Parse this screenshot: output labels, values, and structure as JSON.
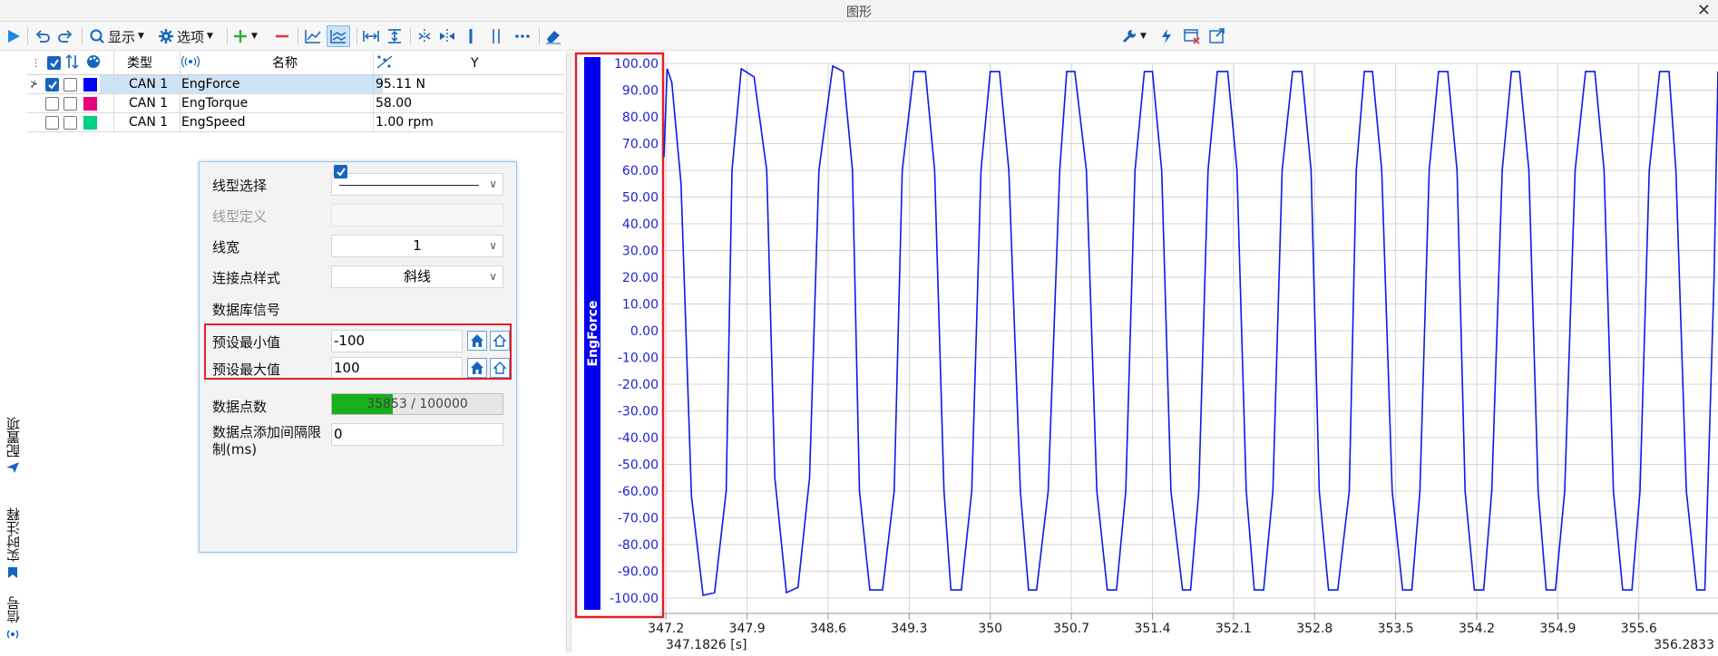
{
  "window": {
    "title": "图形",
    "close": "✕"
  },
  "toolbar": {
    "display_label": "显示",
    "options_label": "选项"
  },
  "colors": {
    "accent": "#1565c0",
    "signal_line": "#0a1ae8",
    "axis_band": "#0000ee",
    "highlight_red": "#e0202a",
    "progress_green": "#18b01a"
  },
  "icons": [
    "play-icon",
    "undo-icon",
    "redo-icon",
    "search-icon",
    "gear-icon",
    "plus-icon",
    "minus-icon",
    "line-chart-icon",
    "multi-line-chart-icon",
    "fit-horizontal-icon",
    "fit-vertical-icon",
    "cursor-cross-icon",
    "compare-icon",
    "cursor-line-icon",
    "double-cursor-icon",
    "more-icon",
    "eraser-icon",
    "wrench-icon",
    "lightning-icon",
    "delete-window-icon",
    "export-icon"
  ],
  "side_tabs": [
    {
      "label": "配置项",
      "icon": "plane-icon"
    },
    {
      "label": "实时注释",
      "icon": "bookmark-icon"
    },
    {
      "label": "信号",
      "icon": "signal-icon"
    }
  ],
  "signal_grid": {
    "headers": {
      "type": "类型",
      "name": "名称",
      "y": "Y"
    },
    "rows": [
      {
        "checked": true,
        "color": "#0000ff",
        "type": "CAN 1",
        "name": "EngForce",
        "value": "95.11 N",
        "selected": true
      },
      {
        "checked": false,
        "color": "#e6007e",
        "type": "CAN 1",
        "name": "EngTorque",
        "value": "58.00",
        "selected": false
      },
      {
        "checked": false,
        "color": "#00d080",
        "type": "CAN 1",
        "name": "EngSpeed",
        "value": "1.00 rpm",
        "selected": false
      }
    ]
  },
  "props": {
    "line_type_label": "线型选择",
    "line_def_label": "线型定义",
    "line_width_label": "线宽",
    "line_width_value": "1",
    "connector_label": "连接点样式",
    "connector_value": "斜线",
    "db_signal_label": "数据库信号",
    "db_signal_checked": true,
    "min_label": "预设最小值",
    "min_value": "-100",
    "max_label": "预设最大值",
    "max_value": "100",
    "points_label": "数据点数",
    "points_text": "35853 / 100000",
    "points_fraction": 0.35853,
    "interval_label": "数据点添加间隔限制(ms)",
    "interval_value": "0"
  },
  "chart_data": {
    "type": "line",
    "ylabel": "EngForce",
    "ylim": [
      -100,
      100
    ],
    "xlim": [
      347.1826,
      356.2833
    ],
    "y_ticks": [
      "100.00",
      "90.00",
      "80.00",
      "70.00",
      "60.00",
      "50.00",
      "40.00",
      "30.00",
      "20.00",
      "10.00",
      "0.00",
      "-10.00",
      "-20.00",
      "-30.00",
      "-40.00",
      "-50.00",
      "-60.00",
      "-70.00",
      "-80.00",
      "-90.00",
      "-100.00"
    ],
    "x_ticks": [
      "347.2",
      "347.9",
      "348.6",
      "349.3",
      "350",
      "350.7",
      "351.4",
      "352.1",
      "352.8",
      "353.5",
      "354.2",
      "354.9",
      "355.6"
    ],
    "x_start_label": "347.1826 [s]",
    "x_end_label": "356.2833",
    "grid": true,
    "series": [
      {
        "x": [
          347.1826,
          347.21,
          347.25,
          347.33,
          347.42,
          347.52,
          347.62,
          347.72,
          347.77,
          347.85,
          347.96,
          348.07,
          348.14,
          348.24,
          348.34,
          348.44,
          348.52,
          348.64,
          348.73,
          348.81,
          348.87,
          348.96,
          349.07,
          349.17,
          349.24,
          349.34,
          349.44,
          349.52,
          349.6,
          349.66,
          349.75,
          349.84,
          349.92,
          350.0,
          350.08,
          350.16,
          350.26,
          350.33,
          350.4,
          350.5,
          350.6,
          350.66,
          350.73,
          350.83,
          350.92,
          351.01,
          351.09,
          351.17,
          351.25,
          351.33,
          351.4,
          351.48,
          351.56,
          351.66,
          351.73,
          351.8,
          351.88,
          351.96,
          352.05,
          352.13,
          352.21,
          352.28,
          352.36,
          352.44,
          352.52,
          352.61,
          352.69,
          352.77,
          352.84,
          352.92,
          353.0,
          353.1,
          353.16,
          353.23,
          353.3,
          353.38,
          353.47,
          353.56,
          353.64,
          353.71,
          353.79,
          353.87,
          353.95,
          354.03,
          354.1,
          354.18,
          354.26,
          354.33,
          354.42,
          354.5,
          354.57,
          354.65,
          354.73,
          354.8,
          354.88,
          354.96,
          355.05,
          355.14,
          355.22,
          355.3,
          355.38,
          355.46,
          355.54,
          355.61,
          355.69,
          355.78,
          355.86,
          355.92,
          356.01,
          356.1,
          356.17,
          356.25,
          356.2833
        ],
        "y": [
          65,
          98,
          93,
          55,
          -62,
          -99,
          -98,
          -60,
          60,
          98,
          95,
          60,
          -55,
          -98,
          -96,
          -55,
          60,
          99,
          97,
          60,
          -60,
          -97,
          -97,
          -60,
          60,
          97,
          97,
          60,
          -60,
          -97,
          -97,
          -60,
          60,
          97,
          97,
          60,
          -60,
          -97,
          -97,
          -60,
          60,
          97,
          97,
          60,
          -60,
          -97,
          -97,
          -60,
          60,
          97,
          97,
          60,
          -60,
          -97,
          -97,
          -60,
          60,
          97,
          97,
          60,
          -60,
          -97,
          -97,
          -60,
          60,
          97,
          97,
          60,
          -60,
          -97,
          -97,
          -60,
          60,
          97,
          97,
          60,
          -60,
          -97,
          -97,
          -60,
          60,
          97,
          97,
          60,
          -60,
          -97,
          -97,
          -60,
          60,
          97,
          97,
          60,
          -60,
          -97,
          -97,
          -60,
          60,
          97,
          97,
          60,
          -60,
          -97,
          -97,
          -60,
          60,
          97,
          97,
          60,
          -60,
          -97,
          -97,
          20,
          97
        ]
      }
    ]
  }
}
